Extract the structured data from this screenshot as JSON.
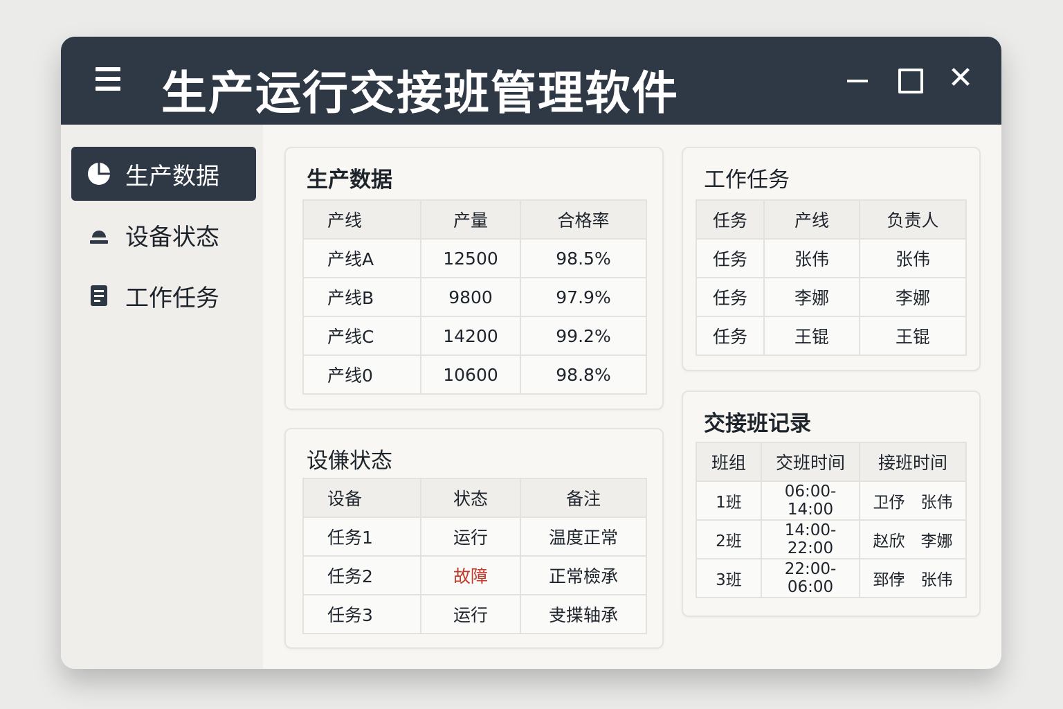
{
  "app": {
    "title": "生产运行交接班管理软件"
  },
  "sidebar": {
    "items": [
      {
        "label": "生产数据",
        "icon": "pie-chart-icon"
      },
      {
        "label": "设备状态",
        "icon": "device-icon"
      },
      {
        "label": "工作任务",
        "icon": "document-icon"
      }
    ]
  },
  "production": {
    "title": "生产数据",
    "headers": [
      "产线",
      "产量",
      "合格率"
    ],
    "rows": [
      [
        "产线A",
        "12500",
        "98.5%"
      ],
      [
        "产线B",
        "9800",
        "97.9%"
      ],
      [
        "产线C",
        "14200",
        "99.2%"
      ],
      [
        "产线0",
        "10600",
        "98.8%"
      ]
    ]
  },
  "equipment": {
    "title": "设傔状态",
    "headers": [
      "设备",
      "状态",
      "备注"
    ],
    "rows": [
      [
        "任务1",
        "运行",
        "温度正常"
      ],
      [
        "任务2",
        "故障",
        "正常檢承"
      ],
      [
        "任务3",
        "运行",
        "叏揲轴承"
      ]
    ],
    "fault_color": "#c0392b"
  },
  "tasks": {
    "title": "工作任务",
    "headers": [
      "任务",
      "产线",
      "负责人"
    ],
    "rows": [
      [
        "任务",
        "张伟",
        "张伟"
      ],
      [
        "任务",
        "李娜",
        "李娜"
      ],
      [
        "任务",
        "王锟",
        "王锟"
      ]
    ]
  },
  "shifts": {
    "title": "交接班记录",
    "headers": [
      "班组",
      "交班时间",
      "接班时间"
    ],
    "rows": [
      [
        "1班",
        "06:00-14:00",
        "卫伃　张伟"
      ],
      [
        "2班",
        "14:00-22:00",
        "赵欣　李娜"
      ],
      [
        "3班",
        "22:00-06:00",
        "郅侼　张伟"
      ]
    ]
  }
}
